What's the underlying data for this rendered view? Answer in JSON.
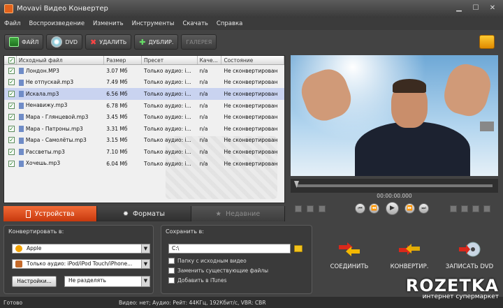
{
  "window": {
    "title": "Movavi Видео Конвертер"
  },
  "menu": [
    "Файл",
    "Воспроизведение",
    "Изменить",
    "Инструменты",
    "Скачать",
    "Справка"
  ],
  "toolbar": {
    "file": "ФАЙЛ",
    "dvd": "DVD",
    "delete": "УДАЛИТЬ",
    "duplicate": "ДУБЛИР.",
    "gallery": "ГАЛЕРЕЯ"
  },
  "file_list": {
    "columns": [
      "Исходный файл",
      "Размер",
      "Пресет",
      "Каче...",
      "Состояние"
    ],
    "rows": [
      {
        "name": "Лондон.MP3",
        "size": "3.07 Мб",
        "preset": "Только аудио: i...",
        "quality": "n/a",
        "status": "Не сконвертирован"
      },
      {
        "name": "Не отпускай.mp3",
        "size": "7.49 Мб",
        "preset": "Только аудио: i...",
        "quality": "n/a",
        "status": "Не сконвертирован"
      },
      {
        "name": "Искала.mp3",
        "size": "6.56 Мб",
        "preset": "Только аудио: i...",
        "quality": "n/a",
        "status": "Не сконвертирован"
      },
      {
        "name": "Ненавижу.mp3",
        "size": "6.78 Мб",
        "preset": "Только аудио: i...",
        "quality": "n/a",
        "status": "Не сконвертирован"
      },
      {
        "name": "Мара - Глянцевой.mp3",
        "size": "3.45 Мб",
        "preset": "Только аудио: i...",
        "quality": "n/a",
        "status": "Не сконвертирован"
      },
      {
        "name": "Мара - Патроны.mp3",
        "size": "3.31 Мб",
        "preset": "Только аудио: i...",
        "quality": "n/a",
        "status": "Не сконвертирован"
      },
      {
        "name": "Мара - Самолёты.mp3",
        "size": "3.15 Мб",
        "preset": "Только аудио: i...",
        "quality": "n/a",
        "status": "Не сконвертирован"
      },
      {
        "name": "Рассветы.mp3",
        "size": "7.10 Мб",
        "preset": "Только аудио: i...",
        "quality": "n/a",
        "status": "Не сконвертирован"
      },
      {
        "name": "Хочешь.mp3",
        "size": "6.04 Мб",
        "preset": "Только аудио: i...",
        "quality": "n/a",
        "status": "Не сконвертирован"
      }
    ],
    "selected_index": 2
  },
  "player": {
    "timecode": "00:00:00.000",
    "progress": 0.0
  },
  "tabs": {
    "devices": "Устройства",
    "formats": "Форматы",
    "recent": "Недавние"
  },
  "convert_panel": {
    "title": "Конвертировать в:",
    "device": "Apple",
    "preset": "Только аудио: iPod/iPod Touch/iPhone...",
    "settings_button": "Настройки...",
    "split": "Не разделять"
  },
  "save_panel": {
    "title": "Сохранить в:",
    "path": "C:\\",
    "opt_source_folder": "Папку с исходным видео",
    "opt_replace": "Заменить существующие файлы",
    "opt_itunes": "Добавить в iTunes"
  },
  "actions": {
    "join": "СОЕДИНИТЬ",
    "convert": "КОНВЕРТИР.",
    "burn": "ЗАПИСАТЬ DVD"
  },
  "status": {
    "left": "Готово",
    "info": "Видео: нет; Аудио: Рейт: 44КГц, 192Кбит/с, VBR: CBR"
  },
  "watermark": {
    "brand": "ROZETKA",
    "tagline": "интернет супермаркет"
  },
  "colors": {
    "accent": "#e5521f",
    "selection": "#c9d3f0",
    "check": "#137a13"
  }
}
